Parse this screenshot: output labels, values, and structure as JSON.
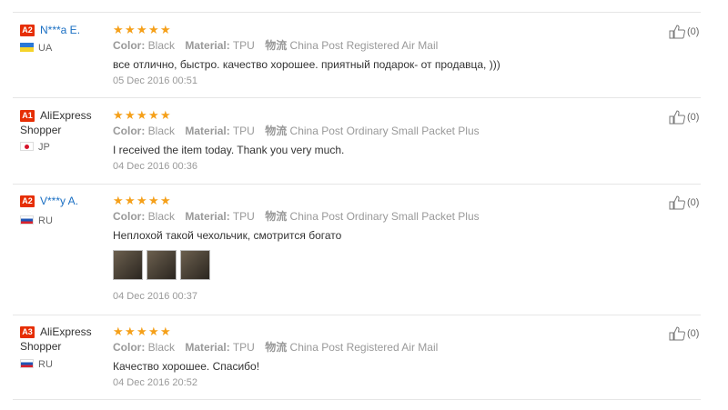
{
  "reviews": [
    {
      "level": "A2",
      "name": "N***a E.",
      "name_line2": "",
      "country": "UA",
      "flag": "ua",
      "color_label": "Color:",
      "color_value": "Black",
      "material_label": "Material:",
      "material_value": "TPU",
      "logistics_label": "物流",
      "logistics_value": "China Post Registered Air Mail",
      "text": "все отлично, быстро. качество хорошее. приятный подарок- от продавца, )))",
      "date": "05 Dec 2016 00:51",
      "helpful": "(0)",
      "photos": []
    },
    {
      "level": "A1",
      "name": "AliExpress",
      "name_line2": "Shopper",
      "country": "JP",
      "flag": "jp",
      "color_label": "Color:",
      "color_value": "Black",
      "material_label": "Material:",
      "material_value": "TPU",
      "logistics_label": "物流",
      "logistics_value": "China Post Ordinary Small Packet Plus",
      "text": "I received the item today. Thank you very much.",
      "date": "04 Dec 2016 00:36",
      "helpful": "(0)",
      "photos": []
    },
    {
      "level": "A2",
      "name": "V***y A.",
      "name_line2": "",
      "country": "RU",
      "flag": "ru",
      "color_label": "Color:",
      "color_value": "Black",
      "material_label": "Material:",
      "material_value": "TPU",
      "logistics_label": "物流",
      "logistics_value": "China Post Ordinary Small Packet Plus",
      "text": "Неплохой такой чехольчик, смотрится богато",
      "date": "04 Dec 2016 00:37",
      "helpful": "(0)",
      "photos": [
        "photo-1",
        "photo-2",
        "photo-3"
      ]
    },
    {
      "level": "A3",
      "name": "AliExpress",
      "name_line2": "Shopper",
      "country": "RU",
      "flag": "ru",
      "color_label": "Color:",
      "color_value": "Black",
      "material_label": "Material:",
      "material_value": "TPU",
      "logistics_label": "物流",
      "logistics_value": "China Post Registered Air Mail",
      "text": "Качество хорошее. Спасибо!",
      "date": "04 Dec 2016 20:52",
      "helpful": "(0)",
      "photos": []
    }
  ],
  "rating_stars": 5,
  "colors": {
    "badge": "#e62e04",
    "star": "#f5a01a",
    "link": "#1a6fc3"
  },
  "icons": {
    "like": "thumbs-up-icon",
    "star": "star-icon"
  }
}
